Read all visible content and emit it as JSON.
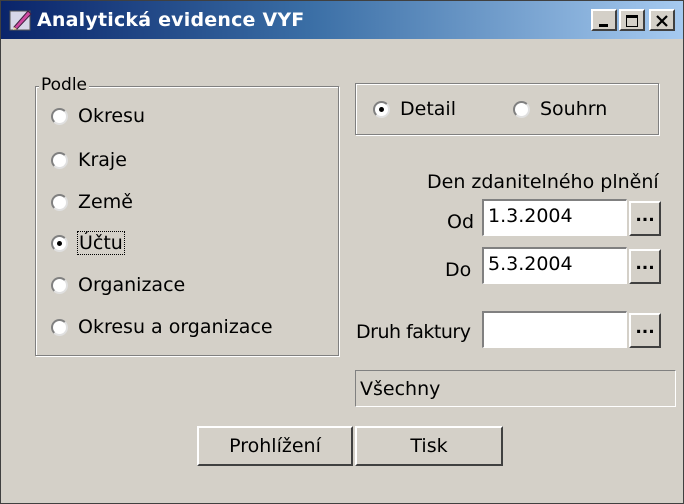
{
  "window": {
    "title": "Analytická evidence VYF",
    "icon": "pen-app-icon"
  },
  "caption_buttons": [
    "minimize",
    "maximize",
    "close"
  ],
  "podle": {
    "legend": "Podle",
    "options": [
      "Okresu",
      "Kraje",
      "Země",
      "Účtu",
      "Organizace",
      "Okresu a organizace"
    ],
    "selected": "Účtu"
  },
  "view_mode": {
    "options": [
      "Detail",
      "Souhrn"
    ],
    "selected": "Detail"
  },
  "date": {
    "heading": "Den zdanitelného plnění",
    "from_label": "Od",
    "from_value": "1.3.2004",
    "to_label": "Do",
    "to_value": "5.3.2004",
    "browse_label": "..."
  },
  "invoice": {
    "label": "Druh faktury",
    "value": "",
    "browse_label": "...",
    "summary": "Všechny"
  },
  "buttons": {
    "browse": "Prohlížení",
    "print": "Tisk"
  }
}
